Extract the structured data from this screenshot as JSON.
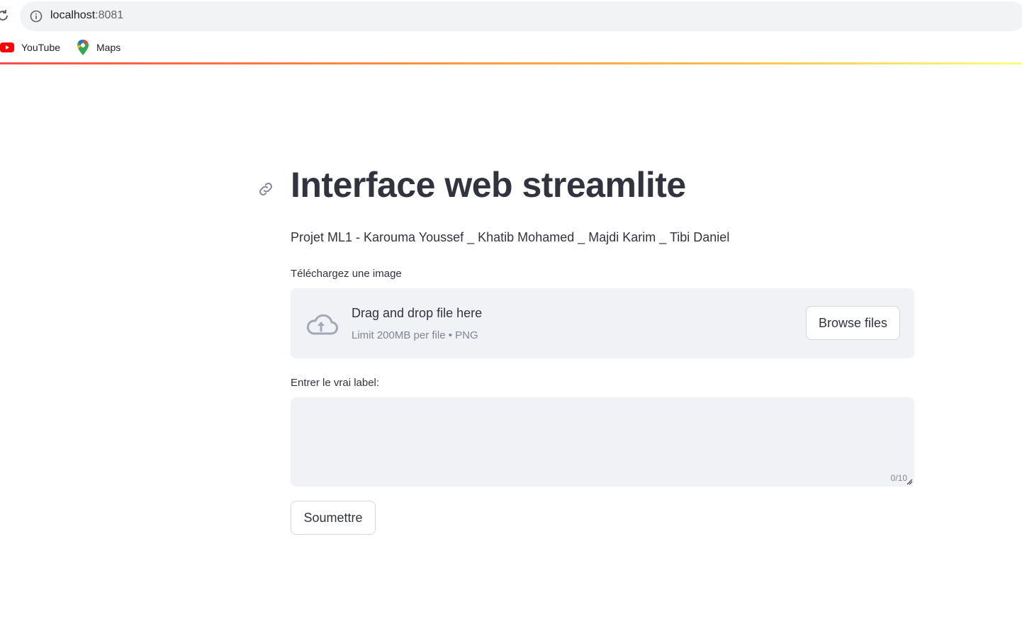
{
  "browser": {
    "url_host": "localhost",
    "url_port": ":8081",
    "bookmarks": [
      {
        "label": "YouTube",
        "icon": "youtube-icon"
      },
      {
        "label": "Maps",
        "icon": "maps-pin-icon"
      }
    ]
  },
  "app": {
    "title": "Interface web streamlite",
    "subtitle": "Projet ML1 - Karouma Youssef _ Khatib Mohamed _ Majdi Karim _ Tibi Daniel",
    "uploader": {
      "label": "Téléchargez une image",
      "drop_text": "Drag and drop file here",
      "limit_text": "Limit 200MB per file • PNG",
      "browse_label": "Browse files",
      "icon": "cloud-upload-icon"
    },
    "true_label": {
      "label": "Entrer le vrai label:",
      "value": "",
      "counter": "0/10"
    },
    "submit_label": "Soumettre"
  },
  "colors": {
    "text": "#31333f",
    "muted": "#808495",
    "input_bg": "#f0f2f6",
    "accent": "#ff4b4b"
  }
}
